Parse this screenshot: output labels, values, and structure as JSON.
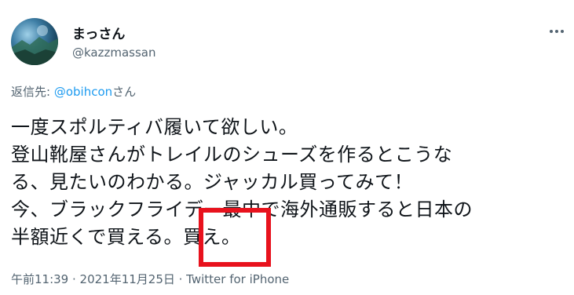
{
  "author": {
    "name": "まっさん",
    "handle": "@kazzmassan",
    "avatar_icon": "avatar-photo"
  },
  "reply": {
    "prefix": "返信先: ",
    "mention": "@obihcon",
    "suffix": "さん"
  },
  "tweet": {
    "lines": [
      "一度スポルティバ履いて欲しい。",
      "登山靴屋さんがトレイルのシューズを作るとこうな",
      "る、見たいのわかる。ジャッカル買ってみて！",
      "今、ブラックフライデー最中で海外通販すると日本の",
      "半額近くで買える。買え。"
    ]
  },
  "meta": {
    "text": "午前11:39 · 2021年11月25日 · Twitter for iPhone"
  },
  "colors": {
    "accent": "#1d9bf0",
    "secondary_text": "#536471",
    "highlight": "#e8121d"
  }
}
